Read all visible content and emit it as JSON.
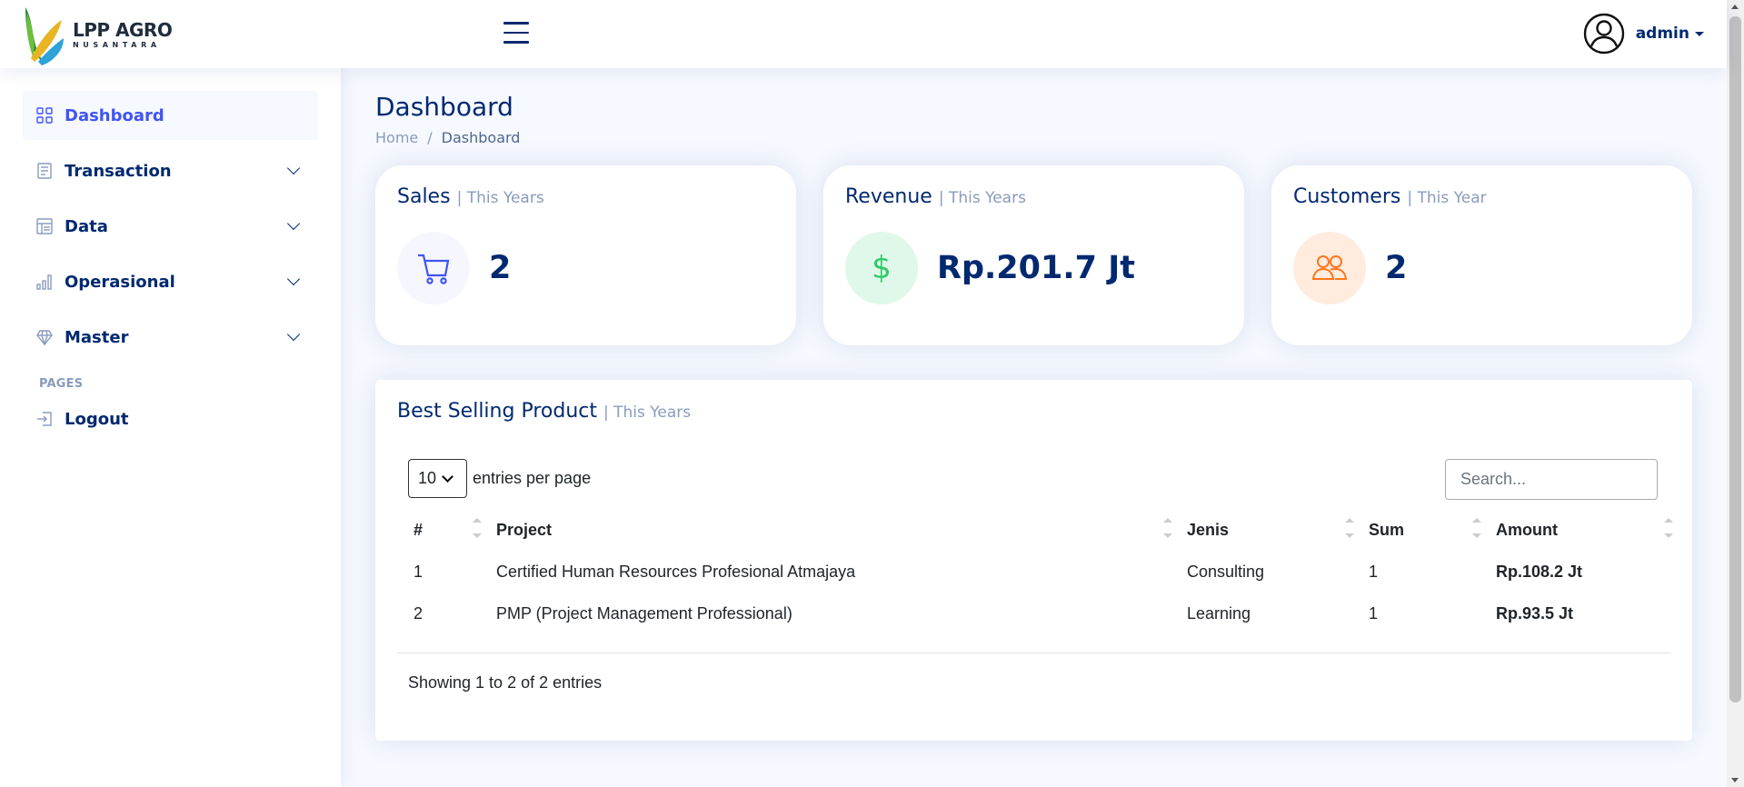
{
  "brand": {
    "title": "LPP AGRO",
    "subtitle": "NUSANTARA"
  },
  "header": {
    "user_name": "admin"
  },
  "sidebar": {
    "items": [
      {
        "label": "Dashboard",
        "icon": "grid-icon",
        "active": true
      },
      {
        "label": "Transaction",
        "icon": "receipt-icon"
      },
      {
        "label": "Data",
        "icon": "table-icon"
      },
      {
        "label": "Operasional",
        "icon": "bar-chart-icon"
      },
      {
        "label": "Master",
        "icon": "gem-icon"
      }
    ],
    "heading": "Pages",
    "logout": "Logout"
  },
  "page": {
    "title": "Dashboard",
    "breadcrumb": [
      "Home",
      "/",
      "Dashboard"
    ]
  },
  "cards": [
    {
      "title": "Sales",
      "period": "| This Years",
      "value": "2",
      "icon": "cart-icon",
      "color": "#4154f1",
      "bg": "#f6f6fe"
    },
    {
      "title": "Revenue",
      "period": "| This Years",
      "value": "Rp.201.7 Jt",
      "icon": "dollar-icon",
      "color": "#2eca6a",
      "bg": "#e0f8e9"
    },
    {
      "title": "Customers",
      "period": "| This Year",
      "value": "2",
      "icon": "people-icon",
      "color": "#ff771d",
      "bg": "#ffecdf"
    }
  ],
  "best_selling": {
    "title": "Best Selling Product",
    "period": "| This Years",
    "per_page_value": "10",
    "per_page_label": "entries per page",
    "search_placeholder": "Search...",
    "columns": [
      "#",
      "Project",
      "Jenis",
      "Sum",
      "Amount"
    ],
    "rows": [
      {
        "no": "1",
        "project": "Certified Human Resources Profesional Atmajaya",
        "jenis": "Consulting",
        "sum": "1",
        "amount": "Rp.108.2 Jt"
      },
      {
        "no": "2",
        "project": "PMP (Project Management Professional)",
        "jenis": "Learning",
        "sum": "1",
        "amount": "Rp.93.5 Jt"
      }
    ],
    "footer": "Showing 1 to 2 of 2 entries"
  }
}
